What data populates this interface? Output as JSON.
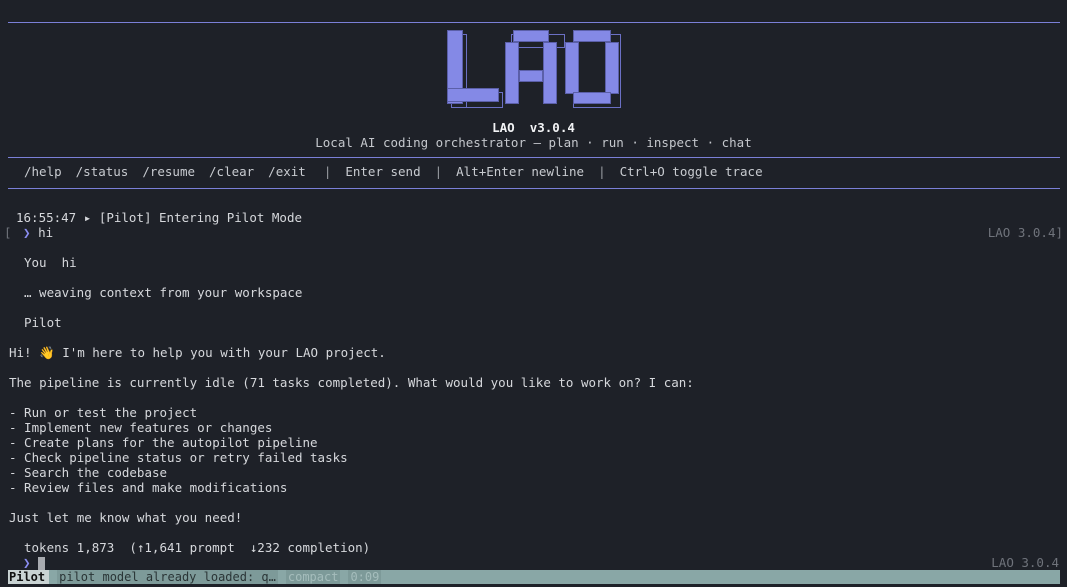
{
  "header": {
    "logo_text": "LAO",
    "app_name": "LAO",
    "version": "v3.0.4",
    "tagline": "Local AI coding orchestrator — plan · run · inspect · chat"
  },
  "help_bar": {
    "commands": [
      "/help",
      "/status",
      "/resume",
      "/clear",
      "/exit"
    ],
    "hints": [
      "Enter send",
      "Alt+Enter newline",
      "Ctrl+O toggle trace"
    ],
    "separator": "|"
  },
  "transcript": {
    "log_time": "16:55:47",
    "log_marker": "▸",
    "log_text": "[Pilot] Entering Pilot Mode",
    "left_bracket": "[",
    "prompt_arrow": "❯",
    "user_input": "hi",
    "right_tag": "LAO 3.0.4]",
    "you_label": "You",
    "you_text": "hi",
    "thinking": "… weaving context from your workspace",
    "pilot_label": "Pilot",
    "greeting": "Hi! 👋 I'm here to help you with your LAO project.",
    "pipeline_status": "The pipeline is currently idle (71 tasks completed). What would you like to work on? I can:",
    "capabilities": [
      "- Run or test the project",
      "- Implement new features or changes",
      "- Create plans for the autopilot pipeline",
      "- Check pipeline status or retry failed tasks",
      "- Search the codebase",
      "- Review files and make modifications"
    ],
    "closing": "Just let me know what you need!",
    "tokens_line": "tokens 1,873  (↑1,641 prompt  ↓232 completion)",
    "bottom_right_tag": "LAO 3.0.4"
  },
  "status_bar": {
    "mode": "Pilot",
    "message": "pilot model already loaded: q…",
    "compact": "compact",
    "timer": "0:09"
  },
  "colors": {
    "background": "#1e2128",
    "accent": "#8489e6",
    "status_bar": "#89a7a6"
  }
}
